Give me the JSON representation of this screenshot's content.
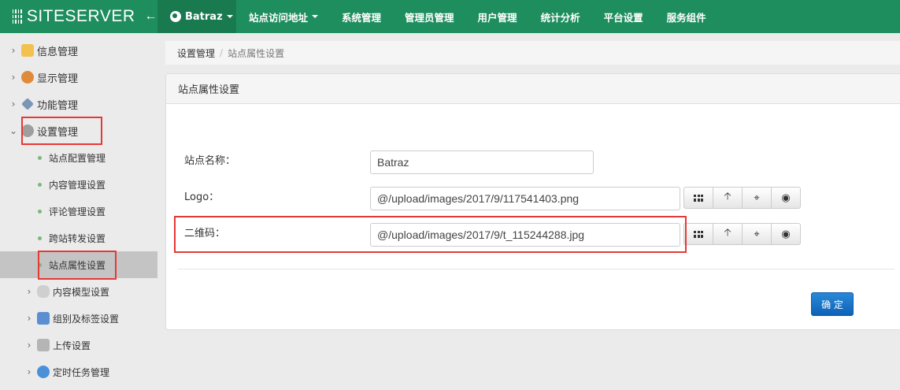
{
  "brand": {
    "name": "SITESERVER",
    "back_icon": "arrow-left-icon"
  },
  "site_switcher": {
    "label": "Batraz",
    "icon": "globe-icon"
  },
  "nav": [
    {
      "label": "站点访问地址",
      "has_caret": true
    },
    {
      "label": "系统管理"
    },
    {
      "label": "管理员管理"
    },
    {
      "label": "用户管理"
    },
    {
      "label": "统计分析"
    },
    {
      "label": "平台设置"
    },
    {
      "label": "服务组件"
    }
  ],
  "sidebar": {
    "items": [
      {
        "label": "信息管理",
        "icon": "folder-lock-icon",
        "expanded": false
      },
      {
        "label": "显示管理",
        "icon": "palette-icon",
        "expanded": false
      },
      {
        "label": "功能管理",
        "icon": "wrench-icon",
        "expanded": false
      },
      {
        "label": "设置管理",
        "icon": "gear-icon",
        "expanded": true
      }
    ],
    "sub_items": [
      {
        "label": "站点配置管理"
      },
      {
        "label": "内容管理设置"
      },
      {
        "label": "评论管理设置"
      },
      {
        "label": "跨站转发设置"
      },
      {
        "label": "站点属性设置",
        "active": true
      }
    ],
    "child_items": [
      {
        "label": "内容模型设置",
        "icon": "cylinder-icon"
      },
      {
        "label": "组别及标签设置",
        "icon": "sitemap-icon"
      },
      {
        "label": "上传设置",
        "icon": "document-icon"
      },
      {
        "label": "定时任务管理",
        "icon": "clock-icon"
      }
    ]
  },
  "breadcrumb": {
    "parent": "设置管理",
    "separator": "/",
    "current": "站点属性设置"
  },
  "panel": {
    "title": "站点属性设置",
    "fields": {
      "site_name": {
        "label": "站点名称：",
        "value": "Batraz"
      },
      "logo": {
        "label": "Logo：",
        "value": "@/upload/images/2017/9/117541403.png"
      },
      "qrcode": {
        "label": "二维码：",
        "value": "@/upload/images/2017/9/t_115244288.jpg"
      }
    },
    "field_buttons": [
      "grid-icon",
      "upload-arrow-icon",
      "crop-icon",
      "eye-icon"
    ],
    "submit_label": "确 定"
  },
  "colors": {
    "topbar": "#1f8e5e",
    "highlight": "#e53935",
    "primary_button": "#0e62b7"
  }
}
